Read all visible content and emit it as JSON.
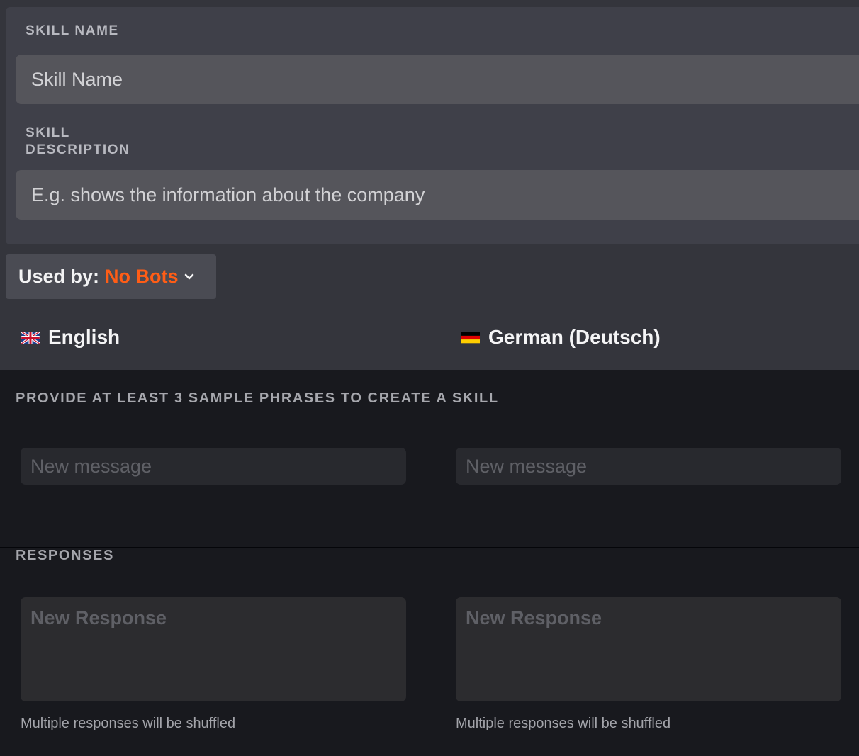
{
  "skill_form": {
    "name_label": "SKILL NAME",
    "name_placeholder": "Skill Name",
    "name_value": "",
    "description_label": "SKILL DESCRIPTION",
    "description_placeholder": "E.g. shows the information about the company",
    "description_value": ""
  },
  "used_by": {
    "label": "Used by:",
    "value": "No Bots",
    "value_color": "#ff5d16"
  },
  "languages": [
    {
      "name": "English",
      "flag_icon": "uk-flag-icon"
    },
    {
      "name": "German (Deutsch)",
      "flag_icon": "germany-flag-icon"
    }
  ],
  "phrases": {
    "label": "PROVIDE AT LEAST 3 SAMPLE PHRASES TO CREATE A SKILL",
    "placeholder_en": "New message",
    "placeholder_de": "New message"
  },
  "responses": {
    "label": "RESPONSES",
    "placeholder_en": "New Response",
    "placeholder_de": "New Response",
    "hint_en": "Multiple responses will be shuffled",
    "hint_de": "Multiple responses will be shuffled"
  }
}
